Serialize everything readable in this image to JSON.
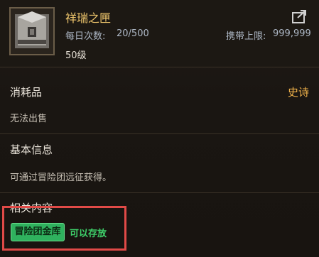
{
  "item": {
    "name": "祥瑞之匣",
    "daily_label": "每日次数:",
    "daily_value": "20/500",
    "carry_label": "携带上限:",
    "carry_value": "999,999",
    "level": "50级",
    "icon": "chest-icon"
  },
  "category": {
    "type": "消耗品",
    "rarity": "史诗"
  },
  "sell_status": "无法出售",
  "basic_info": {
    "title": "基本信息",
    "text": "可通过冒险团远征获得。"
  },
  "related": {
    "title": "相关内容",
    "badge": "冒险团金库",
    "status": "可以存放"
  },
  "colors": {
    "title": "#f0c76d",
    "rarity": "#f0b24a",
    "badge": "#2fb15e",
    "highlight": "#e04a47"
  }
}
